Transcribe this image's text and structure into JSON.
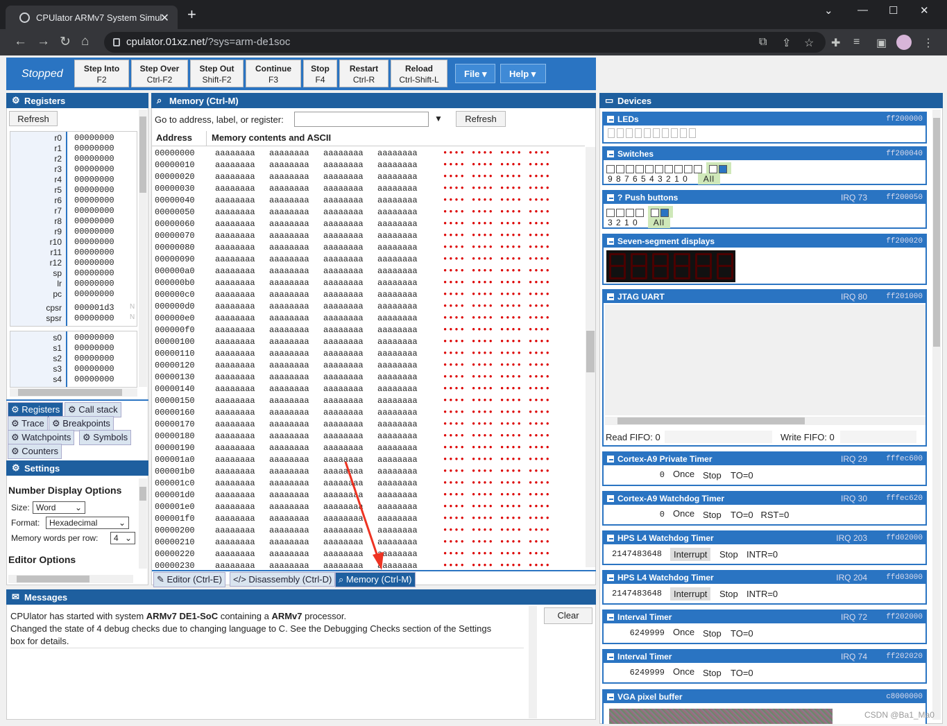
{
  "browser": {
    "tab_title": "CPUlator ARMv7 System Simul",
    "url_host": "cpulator.01xz.net",
    "url_path": "/?sys=arm-de1soc",
    "new_tab": "+",
    "close": "✕",
    "min": "—",
    "max": "☐",
    "win_close": "✕"
  },
  "app": {
    "status": "Stopped",
    "buttons": [
      {
        "label": "Step Into",
        "key": "F2"
      },
      {
        "label": "Step Over",
        "key": "Ctrl-F2"
      },
      {
        "label": "Step Out",
        "key": "Shift-F2"
      },
      {
        "label": "Continue",
        "key": "F3"
      },
      {
        "label": "Stop",
        "key": "F4"
      },
      {
        "label": "Restart",
        "key": "Ctrl-R"
      },
      {
        "label": "Reload",
        "key": "Ctrl-Shift-L"
      }
    ],
    "menus": {
      "file": "File ▾",
      "help": "Help ▾"
    }
  },
  "registers": {
    "title": "Registers",
    "refresh": "Refresh",
    "regs": [
      [
        "r0",
        "00000000"
      ],
      [
        "r1",
        "00000000"
      ],
      [
        "r2",
        "00000000"
      ],
      [
        "r3",
        "00000000"
      ],
      [
        "r4",
        "00000000"
      ],
      [
        "r5",
        "00000000"
      ],
      [
        "r6",
        "00000000"
      ],
      [
        "r7",
        "00000000"
      ],
      [
        "r8",
        "00000000"
      ],
      [
        "r9",
        "00000000"
      ],
      [
        "r10",
        "00000000"
      ],
      [
        "r11",
        "00000000"
      ],
      [
        "r12",
        "00000000"
      ],
      [
        "sp",
        "00000000"
      ],
      [
        "lr",
        "00000000"
      ],
      [
        "pc",
        "00000000"
      ]
    ],
    "cpsr": [
      "cpsr",
      "000001d3",
      "N"
    ],
    "spsr": [
      "spsr",
      "00000000",
      "N"
    ],
    "sregs": [
      [
        "s0",
        "00000000"
      ],
      [
        "s1",
        "00000000"
      ],
      [
        "s2",
        "00000000"
      ],
      [
        "s3",
        "00000000"
      ],
      [
        "s4",
        "00000000"
      ]
    ],
    "tabs": [
      "Registers",
      "Call stack",
      "Trace",
      "Breakpoints",
      "Watchpoints",
      "Symbols",
      "Counters"
    ]
  },
  "settings": {
    "title": "Settings",
    "section": "Number Display Options",
    "size_label": "Size:",
    "size_value": "Word",
    "format_label": "Format:",
    "format_value": "Hexadecimal",
    "words_label": "Memory words per row:",
    "words_value": "4",
    "editor_options": "Editor Options"
  },
  "memory": {
    "title": "Memory (Ctrl-M)",
    "goto_label": "Go to address, label, or register:",
    "refresh": "Refresh",
    "col_address": "Address",
    "col_contents": "Memory contents and ASCII",
    "word": "aaaaaaaa",
    "ascii": "•••• •••• •••• ••••",
    "addresses": [
      "00000000",
      "00000010",
      "00000020",
      "00000030",
      "00000040",
      "00000050",
      "00000060",
      "00000070",
      "00000080",
      "00000090",
      "000000a0",
      "000000b0",
      "000000c0",
      "000000d0",
      "000000e0",
      "000000f0",
      "00000100",
      "00000110",
      "00000120",
      "00000130",
      "00000140",
      "00000150",
      "00000160",
      "00000170",
      "00000180",
      "00000190",
      "000001a0",
      "000001b0",
      "000001c0",
      "000001d0",
      "000001e0",
      "000001f0",
      "00000200",
      "00000210",
      "00000220",
      "00000230"
    ],
    "tabs": [
      "Editor (Ctrl-E)",
      "Disassembly (Ctrl-D)",
      "Memory (Ctrl-M)"
    ]
  },
  "messages": {
    "title": "Messages",
    "clear": "Clear",
    "line1_a": "CPUlator has started with system ",
    "line1_b": "ARMv7 DE1-SoC",
    "line1_c": " containing a ",
    "line1_d": "ARMv7",
    "line1_e": " processor.",
    "line2": "Changed the state of 4 debug checks due to changing language to C. See the Debugging Checks section of the Settings",
    "line3": "box for details."
  },
  "devices": {
    "title": "Devices",
    "leds": {
      "name": "LEDs",
      "addr": "ff200000"
    },
    "switches": {
      "name": "Switches",
      "addr": "ff200040",
      "labels": "9 8 7 6 5 4 3 2 1 0",
      "all": "All"
    },
    "push": {
      "name": "Push buttons",
      "irq": "IRQ 73",
      "addr": "ff200050",
      "labels": "3 2 1 0",
      "all": "All"
    },
    "seven": {
      "name": "Seven-segment displays",
      "addr": "ff200020"
    },
    "jtag": {
      "name": "JTAG UART",
      "irq": "IRQ 80",
      "addr": "ff201000",
      "read": "Read FIFO: 0",
      "write": "Write FIFO: 0"
    },
    "timers": [
      {
        "name": "Cortex-A9 Private Timer",
        "irq": "IRQ 29",
        "addr": "fffec600",
        "value": "0",
        "b1": "Once",
        "b2": "Stop",
        "status": "TO=0"
      },
      {
        "name": "Cortex-A9 Watchdog Timer",
        "irq": "IRQ 30",
        "addr": "fffec620",
        "value": "0",
        "b1": "Once",
        "b2": "Stop",
        "status": "TO=0   RST=0"
      },
      {
        "name": "HPS L4 Watchdog Timer",
        "irq": "IRQ 203",
        "addr": "ffd02000",
        "value": "2147483648",
        "b1": "Interrupt",
        "b2": "Stop",
        "status": "INTR=0"
      },
      {
        "name": "HPS L4 Watchdog Timer",
        "irq": "IRQ 204",
        "addr": "ffd03000",
        "value": "2147483648",
        "b1": "Interrupt",
        "b2": "Stop",
        "status": "INTR=0"
      },
      {
        "name": "Interval Timer",
        "irq": "IRQ 72",
        "addr": "ff202000",
        "value": "6249999",
        "b1": "Once",
        "b2": "Stop",
        "status": "TO=0"
      },
      {
        "name": "Interval Timer",
        "irq": "IRQ 74",
        "addr": "ff202020",
        "value": "6249999",
        "b1": "Once",
        "b2": "Stop",
        "status": "TO=0"
      }
    ],
    "vga": {
      "name": "VGA pixel buffer",
      "addr": "c8000000"
    }
  },
  "watermark": "CSDN @Ba1_Ma0"
}
